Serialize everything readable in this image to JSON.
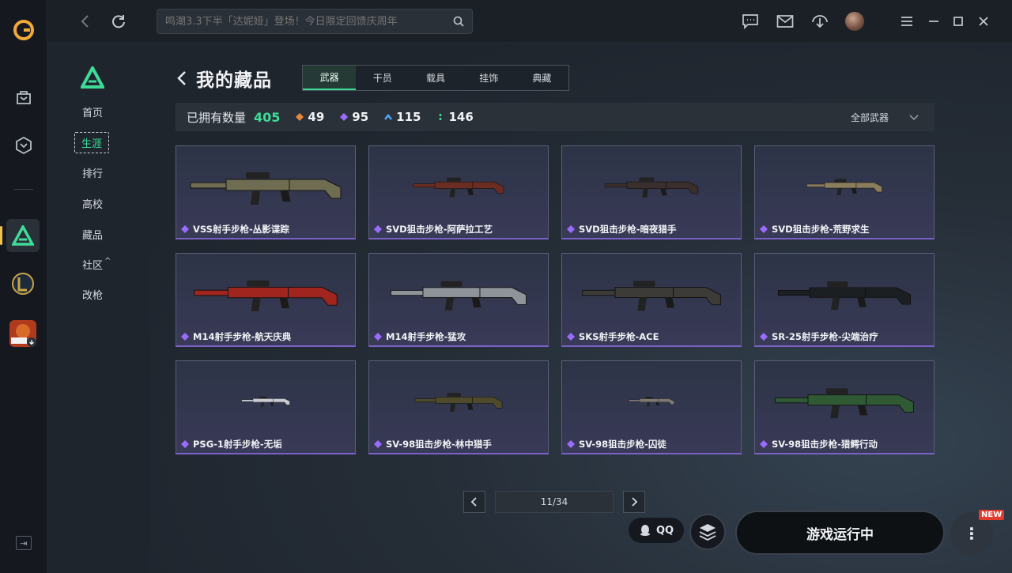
{
  "topbar": {
    "search_placeholder": "鸣潮3.3下半「达妮娅」登场！今日限定回馈庆周年"
  },
  "game_nav": {
    "items": [
      {
        "label": "首页"
      },
      {
        "label": "生涯"
      },
      {
        "label": "排行"
      },
      {
        "label": "高校"
      },
      {
        "label": "藏品"
      },
      {
        "label": "社区"
      },
      {
        "label": "改枪"
      }
    ],
    "community_suffix": "^"
  },
  "main": {
    "title": "我的藏品",
    "tabs": [
      {
        "label": "武器",
        "active": true
      },
      {
        "label": "干员",
        "active": false
      },
      {
        "label": "载具",
        "active": false
      },
      {
        "label": "挂饰",
        "active": false
      },
      {
        "label": "典藏",
        "active": false
      }
    ],
    "stats": {
      "owned_label": "已拥有数量",
      "total": "405",
      "rarities": [
        {
          "value": "49",
          "color": "#e8873a",
          "icon": "orange-diamond-icon"
        },
        {
          "value": "95",
          "color": "#9b6bff",
          "icon": "purple-diamond-icon"
        },
        {
          "value": "115",
          "color": "#4ea5ff",
          "icon": "blue-chevron-icon"
        },
        {
          "value": "146",
          "color": "#3ddc97",
          "icon": "green-tick-icon"
        }
      ],
      "filter_label": "全部武器"
    },
    "items": [
      {
        "name": "VSS射手步枪-丛影谍踪",
        "camo": "#6e6d52"
      },
      {
        "name": "SVD狙击步枪-阿萨拉工艺",
        "camo": "#6b2d22"
      },
      {
        "name": "SVD狙击步枪-暗夜猎手",
        "camo": "#3a2f2c"
      },
      {
        "name": "SVD狙击步枪-荒野求生",
        "camo": "#8b7d5c"
      },
      {
        "name": "M14射手步枪-航天庆典",
        "camo": "#a0251f"
      },
      {
        "name": "M14射手步枪-猛攻",
        "camo": "#8f949a"
      },
      {
        "name": "SKS射手步枪-ACE",
        "camo": "#3d3b38"
      },
      {
        "name": "SR-25射手步枪-尖端治疗",
        "camo": "#1c1f22"
      },
      {
        "name": "PSG-1射手步枪-无垢",
        "camo": "#c8ccd2"
      },
      {
        "name": "SV-98狙击步枪-林中猎手",
        "camo": "#4f4a2c"
      },
      {
        "name": "SV-98狙击步枪-囚徒",
        "camo": "#7c7a72"
      },
      {
        "name": "SV-98狙击步枪-猎鳄行动",
        "camo": "#2f5a34"
      }
    ],
    "rarity_color": "#9b6bff",
    "pagination": "11/34"
  },
  "bottom": {
    "qq_label": "QQ",
    "launch_label": "游戏运行中",
    "new_badge": "NEW"
  }
}
